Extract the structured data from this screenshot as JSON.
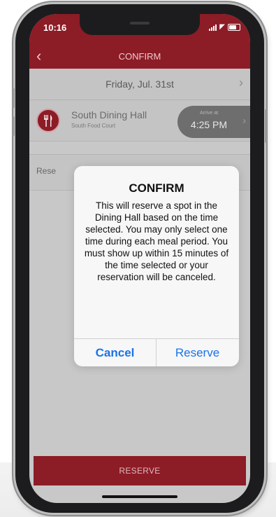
{
  "status_bar": {
    "time": "10:16"
  },
  "nav": {
    "title": "CONFIRM",
    "back_icon": "chevron-left-icon"
  },
  "date_row": {
    "date": "Friday, Jul. 31st"
  },
  "hall": {
    "name": "South Dining Hall",
    "subtitle": "South Food Court",
    "arrive_label": "Arrive at",
    "arrive_time": "4:25 PM"
  },
  "reserve_row": {
    "label": "Rese"
  },
  "alert": {
    "title": "CONFIRM",
    "message": "This will reserve a spot in the Dining Hall based on the time selected.  You may only select one time during each meal period.  You must show up within 15 minutes of the time selected or your reservation will be canceled.",
    "cancel_label": "Cancel",
    "reserve_label": "Reserve"
  },
  "bottom_bar": {
    "label": "RESERVE"
  },
  "colors": {
    "brand": "#8c1c26",
    "link": "#1a73e8"
  }
}
